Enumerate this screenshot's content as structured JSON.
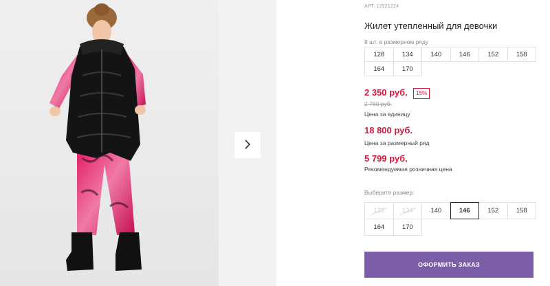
{
  "product": {
    "article": "АРТ. 12321224",
    "title": "Жилет утепленный для девочки"
  },
  "pack": {
    "label": "8 шт. в размерном ряду",
    "sizes": [
      "128",
      "134",
      "140",
      "146",
      "152",
      "158",
      "164",
      "170"
    ]
  },
  "prices": {
    "unit_price": "2 350 руб.",
    "discount_badge": "15%",
    "old_price": "2 760 руб.",
    "unit_caption": "Цена за единицу",
    "pack_price": "18 800 руб.",
    "pack_caption": "Цена за размерный ряд",
    "retail_price": "5 799 руб.",
    "retail_caption": "Рекомендуемая розничная цена"
  },
  "size_selector": {
    "label": "Выберите размер:",
    "options": [
      {
        "value": "128",
        "state": "disabled"
      },
      {
        "value": "134",
        "state": "disabled"
      },
      {
        "value": "140",
        "state": "available"
      },
      {
        "value": "146",
        "state": "selected"
      },
      {
        "value": "152",
        "state": "available"
      },
      {
        "value": "158",
        "state": "available"
      },
      {
        "value": "164",
        "state": "available"
      },
      {
        "value": "170",
        "state": "available"
      }
    ]
  },
  "actions": {
    "order_label": "ОФОРМИТЬ ЗАКАЗ",
    "next_icon": "chevron-right-icon"
  },
  "colors": {
    "accent_price": "#d0193f",
    "order_button": "#7b5ea7"
  }
}
